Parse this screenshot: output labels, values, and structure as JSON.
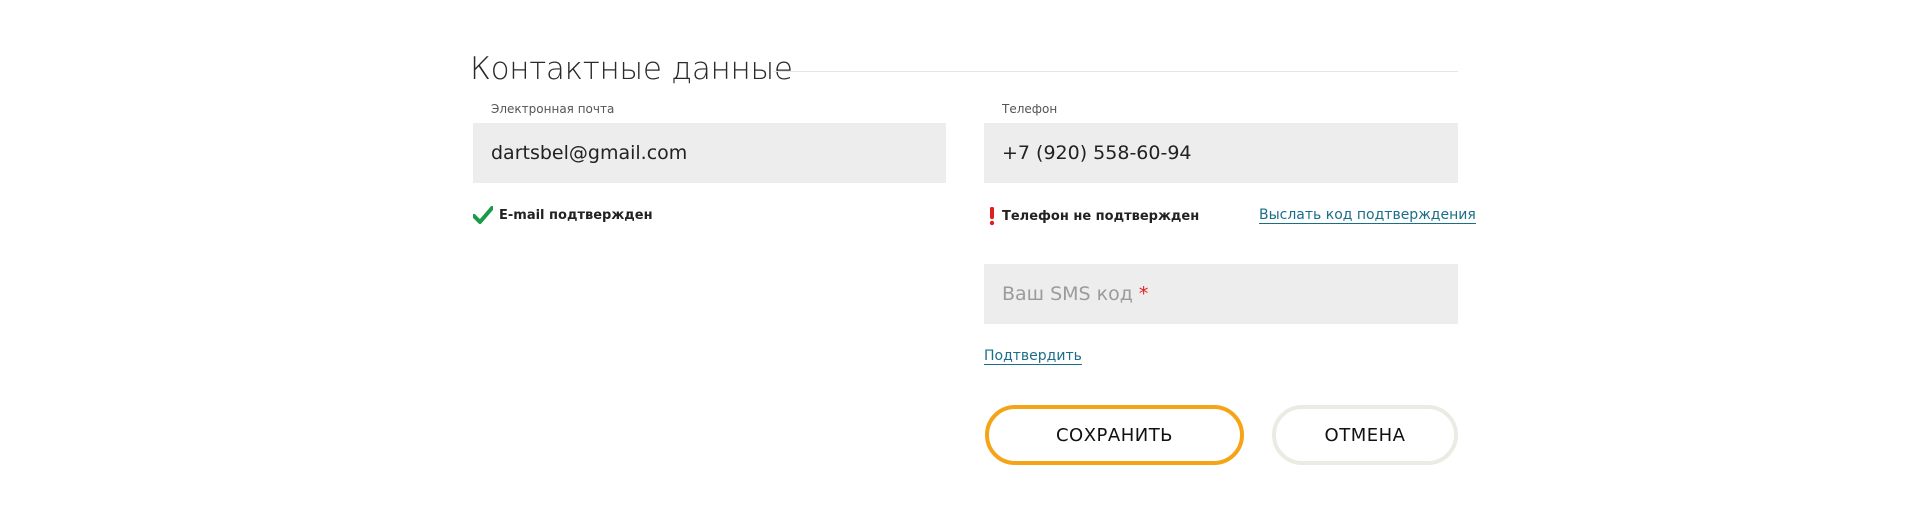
{
  "section": {
    "title": "Контактные данные"
  },
  "email": {
    "label": "Электронная почта",
    "value": "dartsbel@gmail.com",
    "status_text": "E-mail подтвержден",
    "status_icon": "check-icon",
    "status_color": "#1a9a4a"
  },
  "phone": {
    "label": "Телефон",
    "value": "+7 (920) 558-60-94",
    "status_text": "Телефон не подтвержден",
    "status_icon": "exclamation-icon",
    "status_color": "#e02020",
    "send_code_link": "Выслать код подтверждения"
  },
  "sms": {
    "placeholder": "Ваш SMS код",
    "required_mark": "*",
    "confirm_link": "Подтвердить"
  },
  "actions": {
    "save_label": "СОХРАНИТЬ",
    "cancel_label": "ОТМЕНА"
  },
  "colors": {
    "accent": "#f5a417",
    "link": "#1a6e8a",
    "field_bg": "#ededed"
  }
}
